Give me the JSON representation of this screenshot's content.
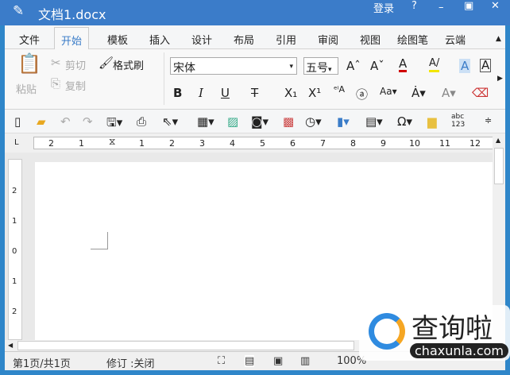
{
  "title": "文档1.docx",
  "titlebar": {
    "login": "登录",
    "help": "?",
    "minimize": "–",
    "restore": "▣",
    "close": "✕"
  },
  "tabs": [
    "文件",
    "开始",
    "模板",
    "插入",
    "设计",
    "布局",
    "引用",
    "审阅",
    "视图",
    "绘图笔",
    "云端"
  ],
  "ribbon": {
    "paste": "粘贴",
    "cut": "剪切",
    "copy": "复制",
    "format_painter": "格式刷",
    "font": "宋体",
    "size": "五号",
    "bold": "B",
    "italic": "I",
    "underline": "U",
    "strike": "T"
  },
  "ruler": {
    "h": [
      "2",
      "1",
      "1",
      "2",
      "3",
      "4",
      "5",
      "6",
      "7",
      "8",
      "9",
      "10",
      "11",
      "12"
    ],
    "v": [
      "2",
      "1",
      "0",
      "1",
      "2"
    ],
    "corner": "L"
  },
  "status": {
    "page": "第1页/共1页",
    "revision": "修订 :关闭",
    "zoom": "100%"
  },
  "watermark": {
    "brand": "查询啦",
    "url": "chaxunla.com"
  },
  "colors": {
    "title": "#3b7cc9",
    "accent": "#3a7cc8",
    "font_color": "#d00000",
    "highlight": "#f2e600"
  }
}
